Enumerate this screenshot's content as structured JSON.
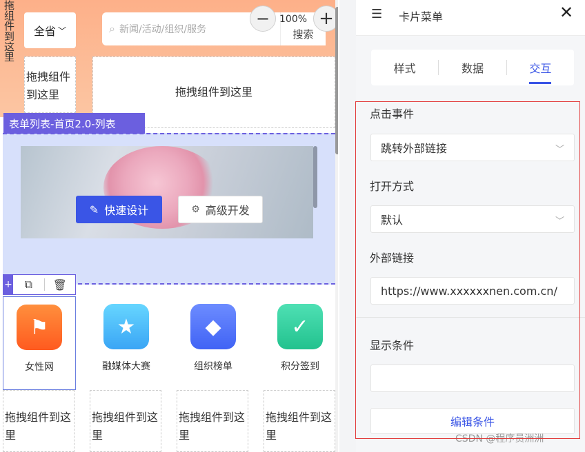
{
  "canvas": {
    "vertical_text": "拖组件到这里",
    "province_select": "全省",
    "search_placeholder": "新闻/活动/组织/服务",
    "search_button": "搜索",
    "zoom": {
      "level": "100%",
      "out": "−",
      "in": "+"
    },
    "drop_left": "拖拽组件到这里",
    "drop_main": "拖拽组件到这里",
    "list_label": "表单列表-首页2.0-列表",
    "banner": {
      "quick_design": "快速设计",
      "advanced_dev": "高级开发"
    },
    "toolbar": {
      "add": "+"
    },
    "icon_cards": [
      {
        "label": "女性网",
        "icon": "flag-icon",
        "color_from": "#ff8f3d",
        "color_to": "#ff5a1f",
        "glyph": "⚑"
      },
      {
        "label": "融媒体大赛",
        "icon": "star-icon",
        "color_from": "#67d6ff",
        "color_to": "#3aa5f5",
        "glyph": "★"
      },
      {
        "label": "组织榜单",
        "icon": "diamond-icon",
        "color_from": "#6d8cff",
        "color_to": "#4063f5",
        "glyph": "◆"
      },
      {
        "label": "积分签到",
        "icon": "calendar-check-icon",
        "color_from": "#4fe0b4",
        "color_to": "#22c28e",
        "glyph": "✓"
      }
    ],
    "drop_small": [
      "拖拽组件到这里",
      "拖拽组件到这里",
      "拖拽组件到这里",
      "拖拽组件到这里"
    ]
  },
  "panel": {
    "title": "卡片菜单",
    "close": "✕",
    "tabs": [
      "样式",
      "数据",
      "交互"
    ],
    "active_tab": "交互",
    "click_event": {
      "label": "点击事件",
      "value": "跳转外部链接"
    },
    "open_mode": {
      "label": "打开方式",
      "value": "默认"
    },
    "external_link": {
      "label": "外部链接",
      "value": "https://www.xxxxxxnen.com.cn/"
    },
    "display_condition": {
      "label": "显示条件",
      "value": ""
    },
    "edit_condition_button": "编辑条件"
  },
  "watermark": "CSDN @程序员洲洲",
  "colors": {
    "accent": "#3a55e6",
    "list_purple": "#6b5fdf",
    "highlight_red": "#e23b3b"
  }
}
